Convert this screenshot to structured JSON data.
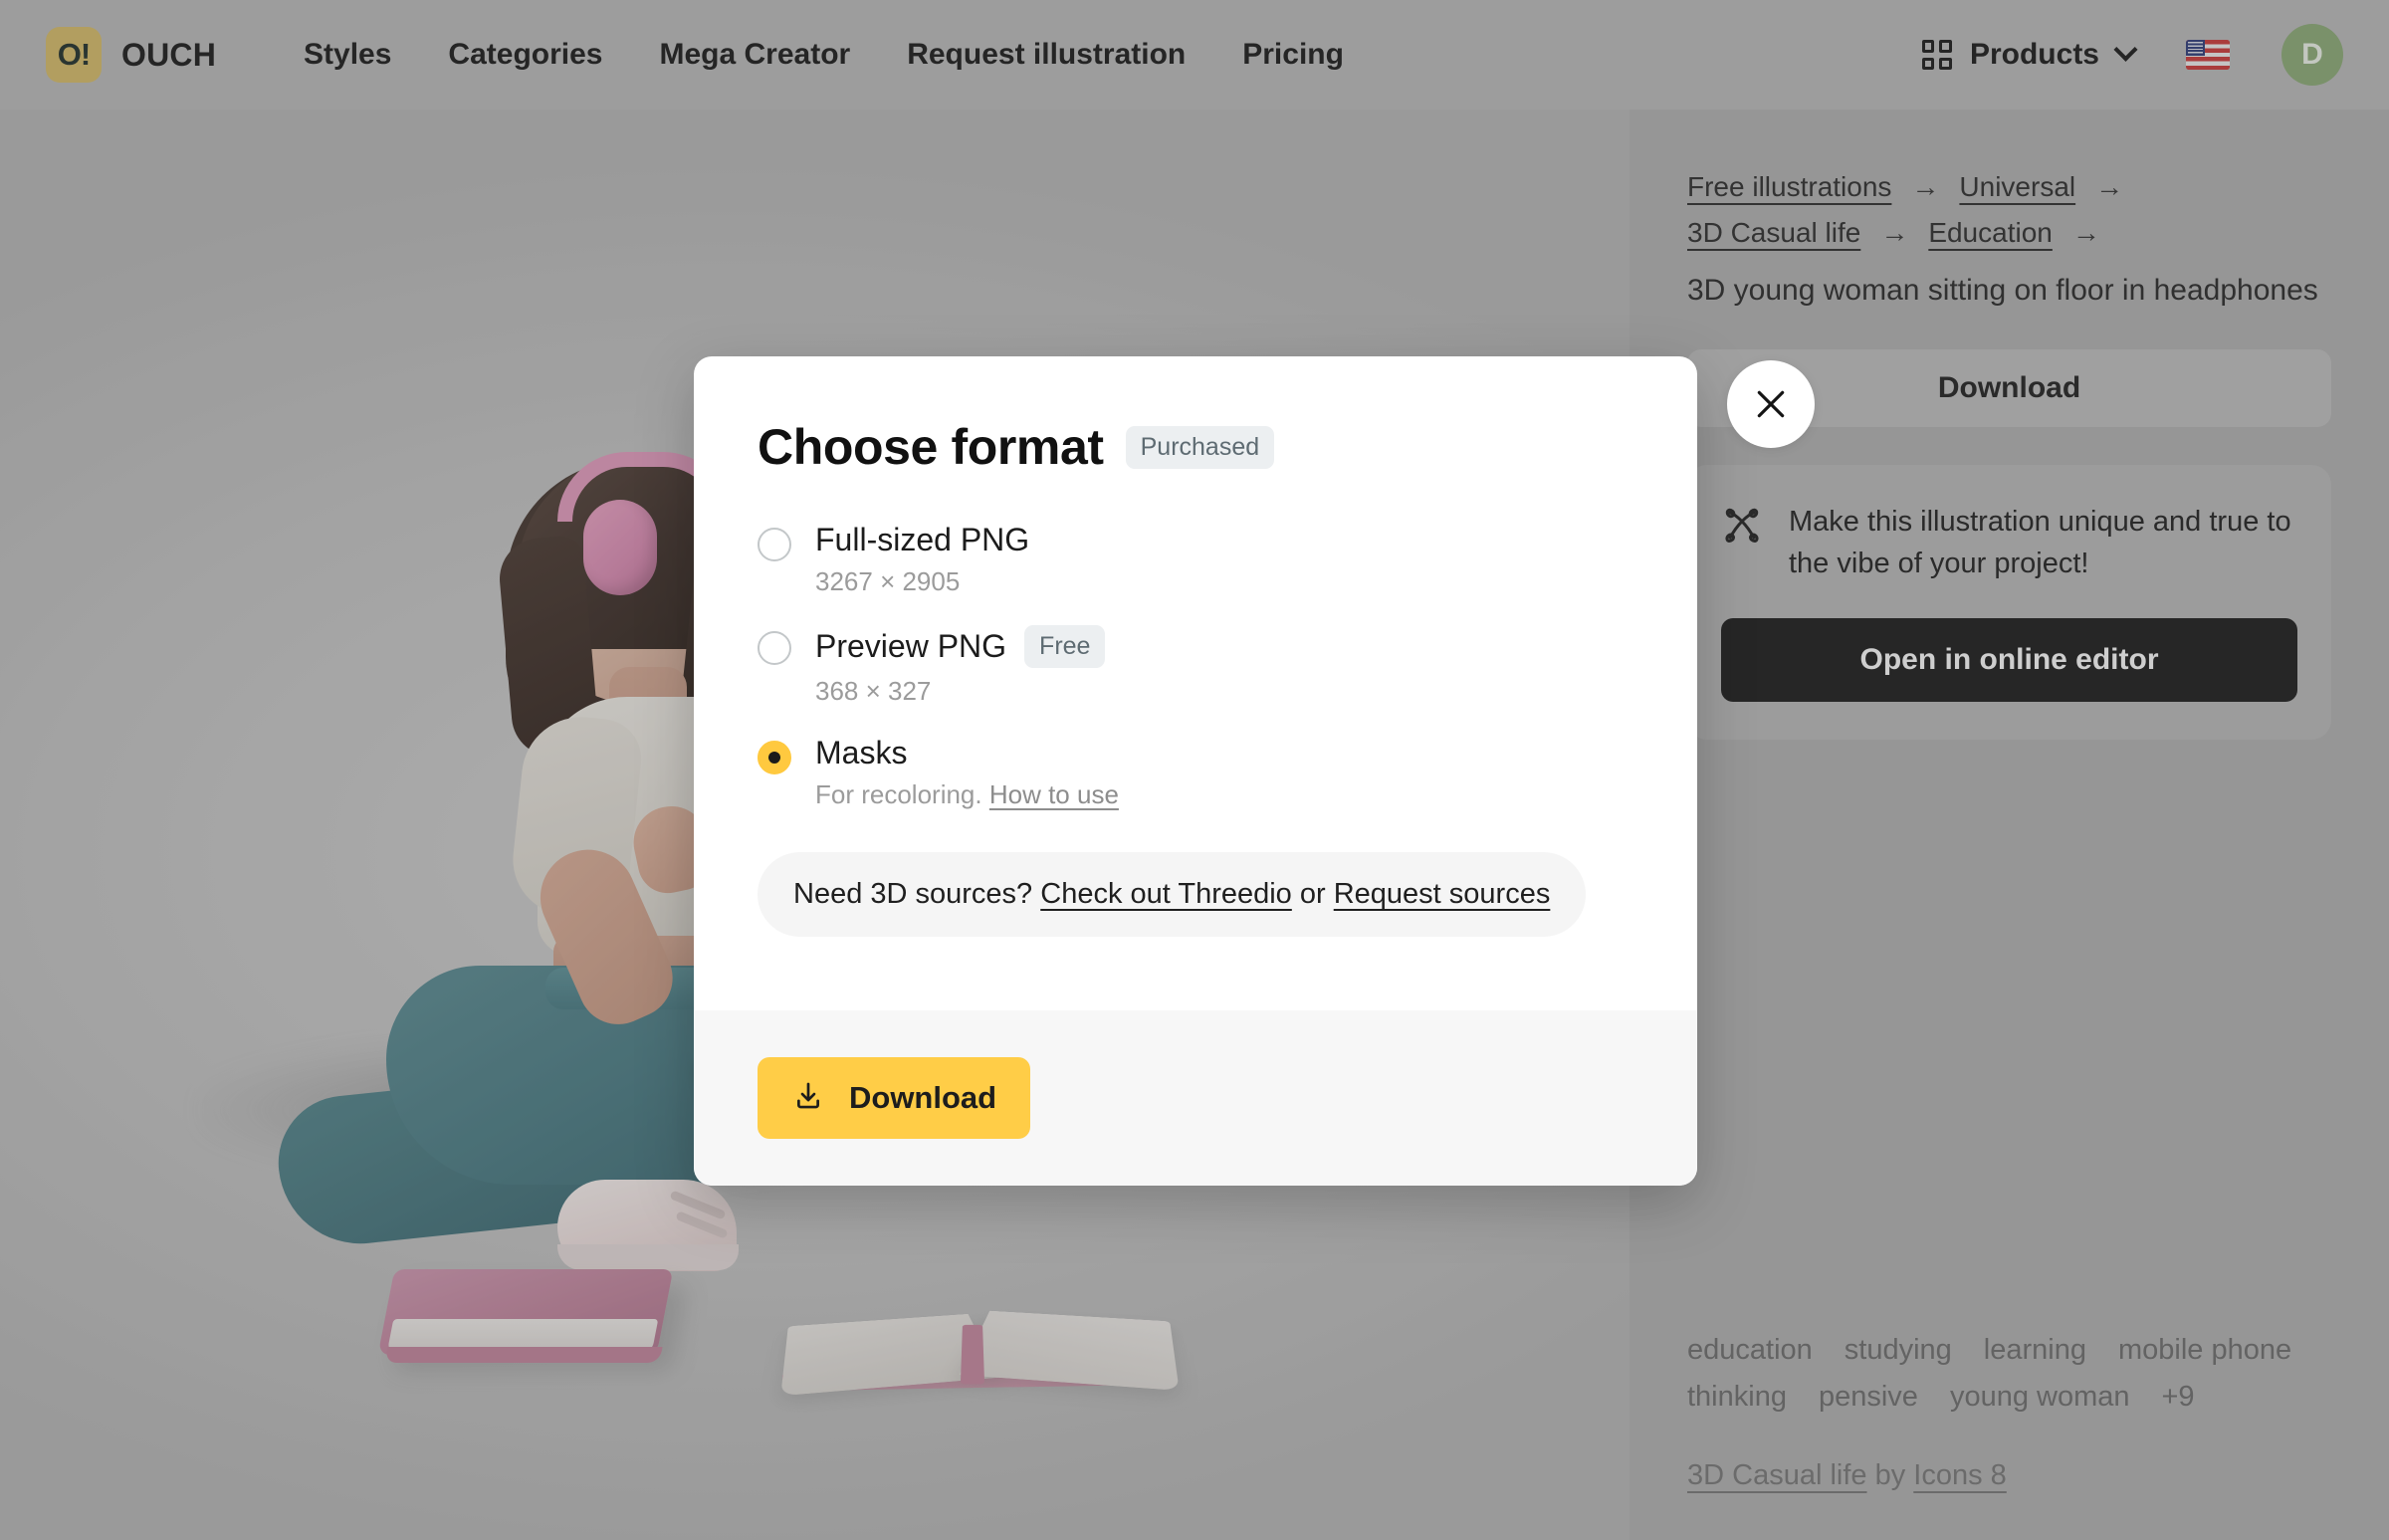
{
  "header": {
    "logo_badge": "O!",
    "logo_text": "OUCH",
    "nav": [
      {
        "label": "Styles"
      },
      {
        "label": "Categories"
      },
      {
        "label": "Mega Creator"
      },
      {
        "label": "Request illustration"
      },
      {
        "label": "Pricing"
      }
    ],
    "products_label": "Products",
    "locale_flag": "us-flag",
    "avatar_initial": "D"
  },
  "sidebar": {
    "breadcrumbs_row1": [
      {
        "label": "Free illustrations"
      },
      {
        "label": "Universal"
      }
    ],
    "breadcrumbs_row2": [
      {
        "label": "3D Casual life"
      },
      {
        "label": "Education"
      }
    ],
    "arrow": "→",
    "illustration_title": "3D young woman sitting on floor in headphones",
    "download_label": "Download",
    "editor_card": {
      "text": "Make this illustration unique and true to the vibe of your project!",
      "button_label": "Open in online editor"
    },
    "tags": [
      "education",
      "studying",
      "learning",
      "mobile phone",
      "thinking",
      "pensive",
      "young woman",
      "+9"
    ],
    "credit_prefix": "3D Casual life",
    "credit_middle": " by ",
    "credit_author": "Icons 8"
  },
  "modal": {
    "title": "Choose format",
    "badge": "Purchased",
    "options": [
      {
        "label": "Full-sized PNG",
        "badge": "",
        "sub": "3267 × 2905",
        "sub_link": "",
        "selected": false
      },
      {
        "label": "Preview PNG",
        "badge": "Free",
        "sub": "368 × 327",
        "sub_link": "",
        "selected": false
      },
      {
        "label": "Masks",
        "badge": "",
        "sub": "For recoloring. ",
        "sub_link": "How to use",
        "selected": true
      }
    ],
    "sources": {
      "prefix": "Need 3D sources? ",
      "link1": "Check out Threedio",
      "middle": " or ",
      "link2": "Request sources"
    },
    "download_label": "Download",
    "close_label": "Close"
  },
  "colors": {
    "accent_yellow": "#ffcd47",
    "logo_gold": "#d9be6b",
    "editor_button": "#1d1d1d",
    "avatar_green": "#8ead78",
    "page_bg": "#bdbdbd"
  }
}
